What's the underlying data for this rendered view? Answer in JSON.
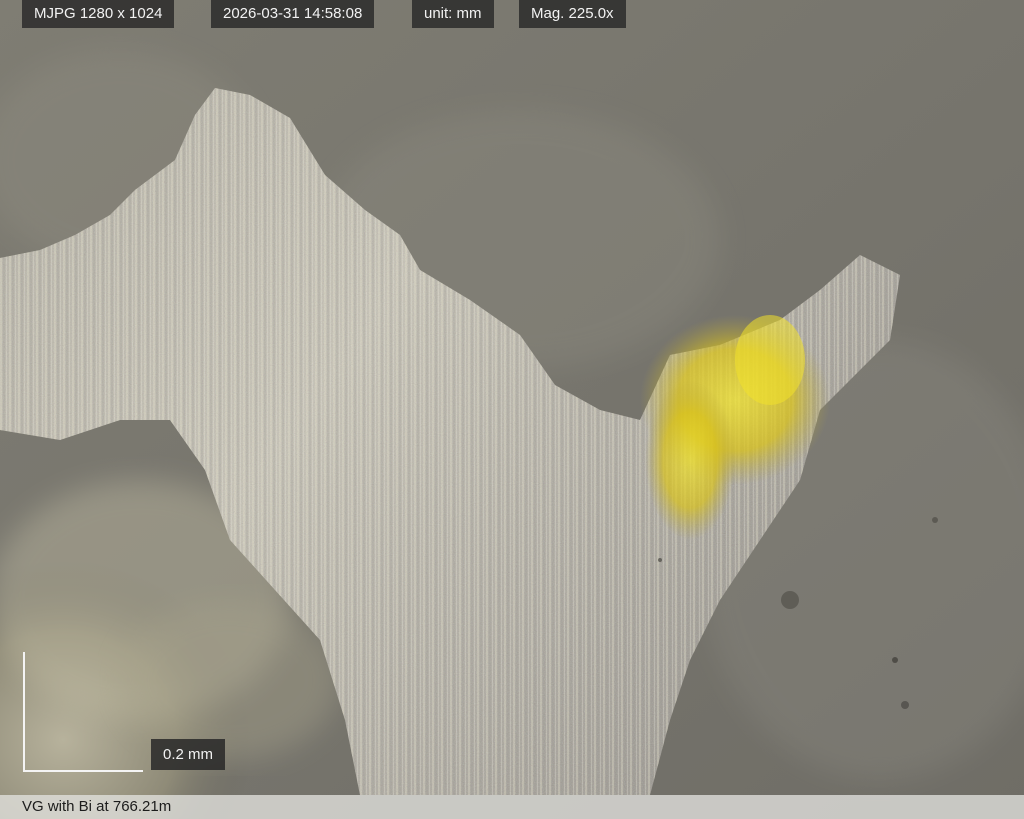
{
  "hud": {
    "resolution": "MJPG 1280 x 1024",
    "timestamp": "2026-03-31 14:58:08",
    "unit": "unit: mm",
    "magnification": "Mag. 225.0x"
  },
  "scale_bar": {
    "label": "0.2 mm"
  },
  "caption": {
    "text": "VG with Bi at 766.21m"
  },
  "colors": {
    "matrix": "#7d7a72",
    "grain": "#b9b6ad",
    "grain_highlight": "#e9e2c4",
    "gold_inclusion": "#e8d21e",
    "hud_background": "#2a2a2a",
    "caption_background": "#e1e1de"
  }
}
